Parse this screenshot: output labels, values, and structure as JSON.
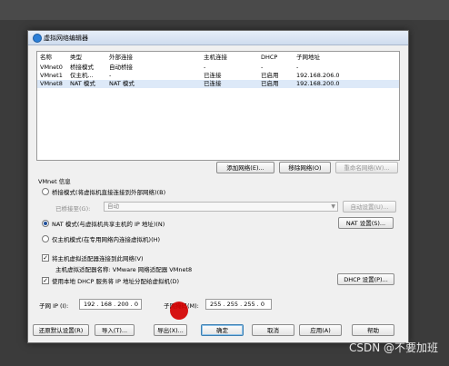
{
  "dialog": {
    "title": "虚拟网络编辑器"
  },
  "table": {
    "headers": [
      "名称",
      "类型",
      "外部连接",
      "主机连接",
      "DHCP",
      "子网地址"
    ],
    "rows": [
      [
        "VMnet0",
        "桥接模式",
        "自动桥接",
        "-",
        "-",
        "-"
      ],
      [
        "VMnet1",
        "仅主机...",
        "-",
        "已连接",
        "已启用",
        "192.168.206.0"
      ],
      [
        "VMnet8",
        "NAT 模式",
        "NAT 模式",
        "已连接",
        "已启用",
        "192.168.200.0"
      ]
    ],
    "selected_row": 2
  },
  "table_buttons": {
    "add": "添加网络(E)...",
    "remove": "移除网络(O)",
    "rename": "重命名网络(W)..."
  },
  "vmnet_info": {
    "title": "VMnet 信息",
    "bridged": "桥接模式(将虚拟机直接连接到外部网络)(B)",
    "bridged_to_label": "已桥接至(G):",
    "bridged_to_value": "自动",
    "auto_settings": "自动设置(U)...",
    "nat": "NAT 模式(与虚拟机共享主机的 IP 地址)(N)",
    "nat_settings": "NAT 设置(S)...",
    "host_only": "仅主机模式(在专用网络内连接虚拟机)(H)",
    "connect_adapter": "将主机虚拟适配器连接到此网络(V)",
    "adapter_name": "主机虚拟适配器名称: VMware 网络适配器 VMnet8",
    "use_dhcp": "使用本地 DHCP 服务将 IP 地址分配给虚拟机(D)",
    "dhcp_settings": "DHCP 设置(P)...",
    "subnet_ip_label": "子网 IP (I):",
    "subnet_ip": "192 . 168 . 200 . 0",
    "subnet_mask_label": "子网掩码(M):",
    "subnet_mask": "255 . 255 . 255 . 0"
  },
  "footer": {
    "restore": "还原默认设置(R)",
    "import": "导入(T)...",
    "export": "导出(X)...",
    "ok": "确定",
    "cancel": "取消",
    "apply": "应用(A)",
    "help": "帮助"
  },
  "watermark": "CSDN @不要加班"
}
